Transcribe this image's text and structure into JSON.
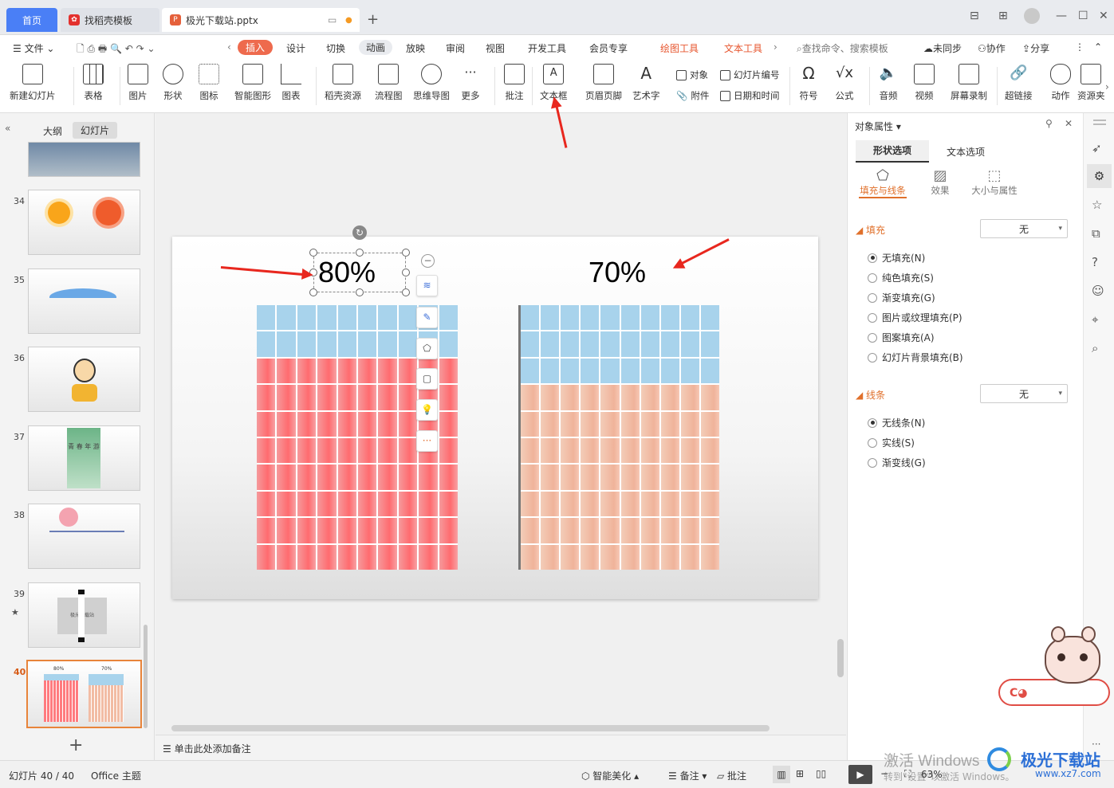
{
  "tabs": {
    "home": "首页",
    "template": "找稻壳模板",
    "file": "极光下载站.pptx"
  },
  "menu": {
    "file": "文件",
    "items": [
      "设计",
      "切换",
      "动画",
      "放映",
      "审阅",
      "视图",
      "开发工具",
      "会员专享"
    ],
    "active": "插入",
    "drawing_tools": "绘图工具",
    "text_tools": "文本工具",
    "search": "查找命令、搜索模板",
    "sync": "未同步",
    "collab": "协作",
    "share": "分享"
  },
  "ribbon": {
    "new_slide": "新建幻灯片",
    "table": "表格",
    "picture": "图片",
    "shape": "形状",
    "icon": "图标",
    "smart": "智能图形",
    "chart": "图表",
    "docer": "稻壳资源",
    "flow": "流程图",
    "mind": "思维导图",
    "more": "更多",
    "comment": "批注",
    "textbox": "文本框",
    "header": "页眉页脚",
    "art": "艺术字",
    "object": "对象",
    "slide_no": "幻灯片编号",
    "attach": "附件",
    "datetime": "日期和时间",
    "symbol": "符号",
    "formula": "公式",
    "audio": "音频",
    "video": "视频",
    "record": "屏幕录制",
    "link": "超链接",
    "action": "动作",
    "resource": "资源夹"
  },
  "left_pane": {
    "outline": "大纲",
    "slides": "幻灯片",
    "numbers": [
      "34",
      "35",
      "36",
      "37",
      "38",
      "39",
      "40"
    ],
    "thumb40_a": "80%",
    "thumb40_b": "70%",
    "thumb37_text": "青 春 年 游",
    "thumb39_text": "极光下载站"
  },
  "slide": {
    "left_pct": "80%",
    "right_pct": "70%",
    "left_blue_rows": 2,
    "right_blue_rows": 3,
    "rows": 10,
    "cols": 10
  },
  "panel": {
    "title": "对象属性",
    "tab_shape": "形状选项",
    "tab_text": "文本选项",
    "sub_fill": "填充与线条",
    "sub_effect": "效果",
    "sub_size": "大小与属性",
    "fill_label": "填充",
    "fill_value": "无",
    "fill_options": [
      "无填充(N)",
      "纯色填充(S)",
      "渐变填充(G)",
      "图片或纹理填充(P)",
      "图案填充(A)",
      "幻灯片背景填充(B)"
    ],
    "line_label": "线条",
    "line_value": "无",
    "line_options": [
      "无线条(N)",
      "实线(S)",
      "渐变线(G)"
    ]
  },
  "notes": "单击此处添加备注",
  "status": {
    "slide": "幻灯片 40 / 40",
    "theme": "Office 主题",
    "beautify": "智能美化",
    "notes": "备注",
    "comment": "批注",
    "zoom": "63%"
  },
  "watermark": {
    "activate": "激活 Windows",
    "activate_sub": "转到\"设置\"以激活 Windows。",
    "logo": "极光下载站",
    "url": "www.xz7.com"
  },
  "colors": {
    "accent": "#4a7ff6",
    "insert_tab": "#ee6a4d",
    "red_bars": "#ff6b6f",
    "peach_bars": "#f0b39a",
    "blue_cells": "#a8d3ec",
    "arrow": "#e8271e"
  }
}
